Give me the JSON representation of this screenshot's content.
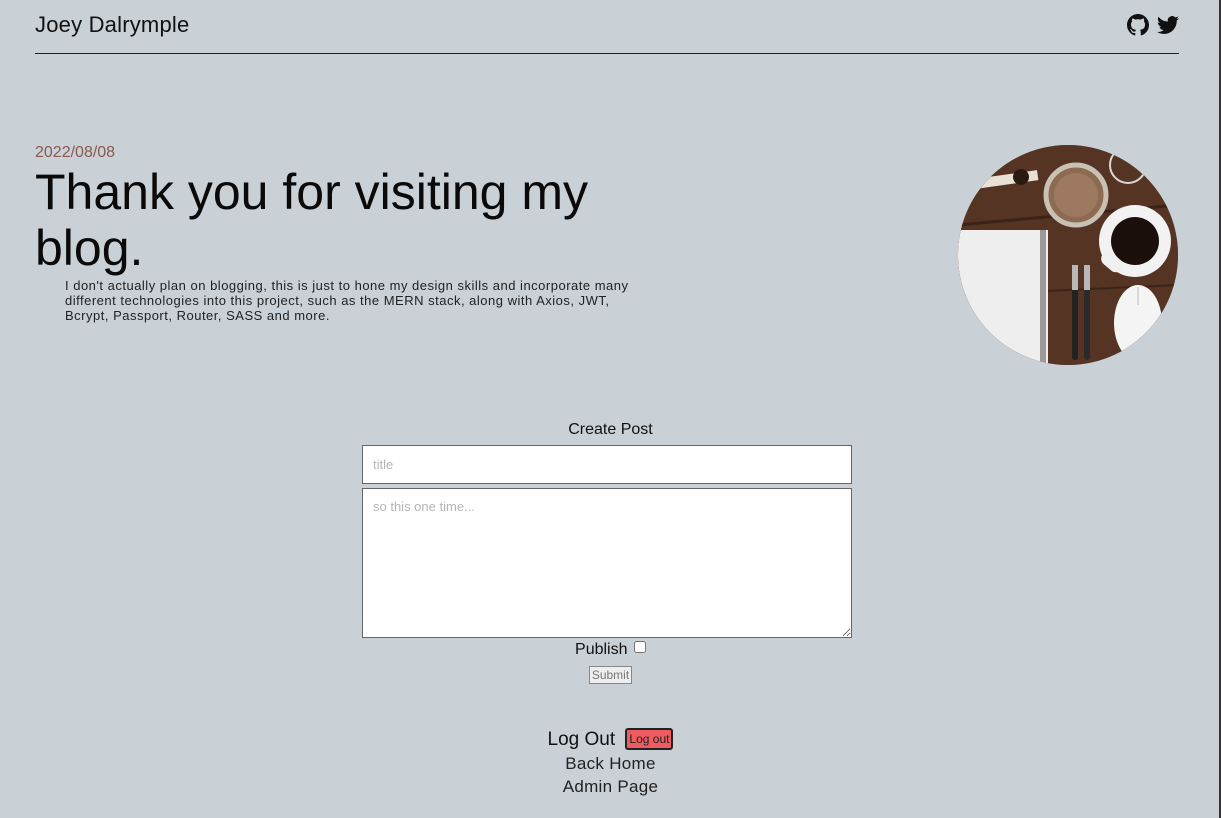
{
  "header": {
    "site_name": "Joey Dalrymple",
    "social_icons": [
      "github-icon",
      "twitter-icon"
    ]
  },
  "hero": {
    "date": "2022/08/08",
    "title": "Thank you for visiting my blog.",
    "description": "I don't actually plan on blogging, this is just to hone my design skills and incorporate many different technologies into this project, such as the MERN stack, along with Axios, JWT, Bcrypt, Passport, Router, SASS and more."
  },
  "create_post": {
    "heading": "Create Post",
    "title_placeholder": "title",
    "body_placeholder": "so this one time...",
    "publish_label": "Publish",
    "publish_checked": false,
    "submit_label": "Submit"
  },
  "footer": {
    "logout_label": "Log Out",
    "logout_button": "Log out",
    "back_home": "Back Home",
    "admin_page": "Admin Page"
  },
  "colors": {
    "background": "#c9d0d6",
    "date": "#8a5a4e",
    "logout_button": "#ee5b61"
  }
}
